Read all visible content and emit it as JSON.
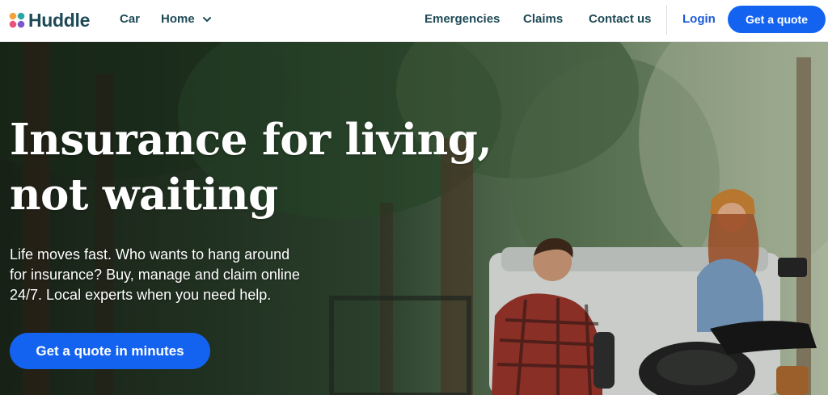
{
  "nav": {
    "brand": "Huddle",
    "links": [
      "Car",
      "Home",
      "Emergencies",
      "Claims",
      "Contact us"
    ],
    "login": "Login",
    "cta": "Get a quote"
  },
  "hero": {
    "headline_line1": "Insurance for living,",
    "headline_line2": "not waiting",
    "subtext_line1": "Life moves fast. Who wants to hang around",
    "subtext_line2": "for insurance? Buy, manage and claim online",
    "subtext_line3": "24/7. Local experts when you need help.",
    "cta": "Get a quote in minutes"
  },
  "icons": {
    "logo": "huddle-logo-icon",
    "home_dropdown": "chevron-down-icon"
  },
  "colors": {
    "brand_text": "#1e4a55",
    "accent_blue": "#1463f0",
    "login_blue": "#1a5ad6"
  }
}
